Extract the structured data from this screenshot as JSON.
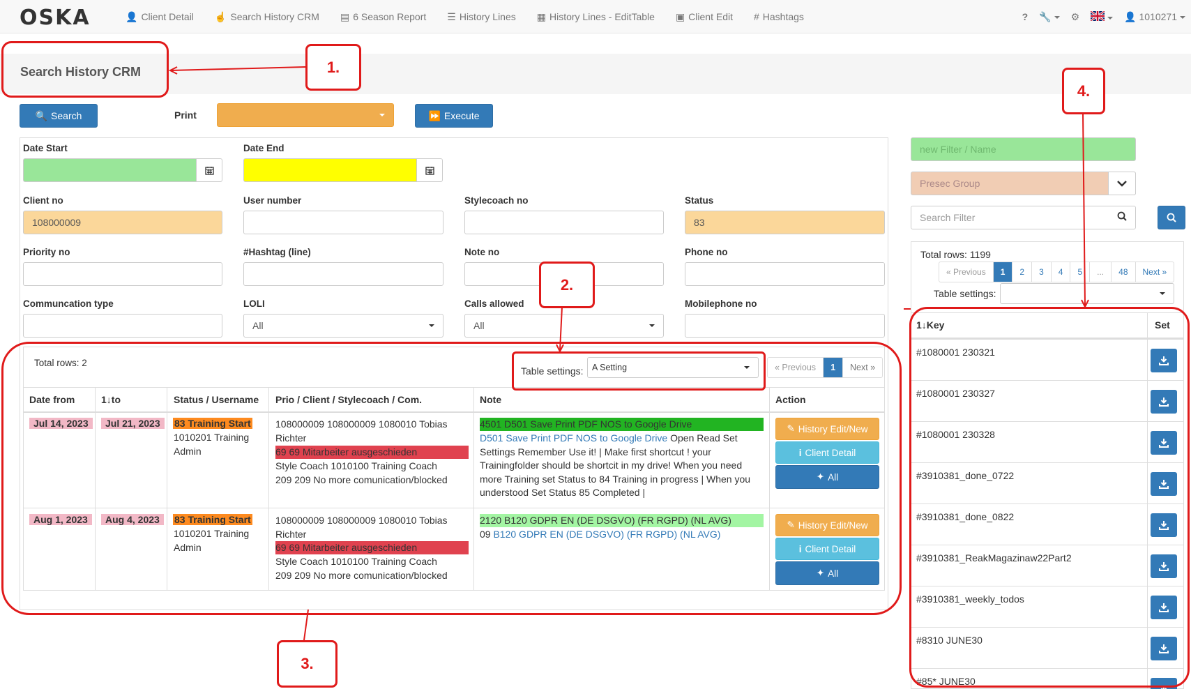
{
  "brand": "OSKA",
  "nav": {
    "items": [
      {
        "label": "Client Detail"
      },
      {
        "label": "Search History CRM"
      },
      {
        "label": "6 Season Report"
      },
      {
        "label": "History Lines"
      },
      {
        "label": "History Lines - EditTable"
      },
      {
        "label": "Client Edit"
      },
      {
        "label": "Hashtags"
      }
    ],
    "help": "?",
    "user": "1010271"
  },
  "page": {
    "title": "Search History CRM"
  },
  "toolbar": {
    "search_label": "Search",
    "print_label": "Print",
    "print_value": "",
    "execute_label": "Execute"
  },
  "form": {
    "date_start": {
      "label": "Date Start",
      "value": ""
    },
    "date_end": {
      "label": "Date End",
      "value": ""
    },
    "client_no": {
      "label": "Client no",
      "value": "108000009"
    },
    "user_number": {
      "label": "User number",
      "value": ""
    },
    "stylecoach_no": {
      "label": "Stylecoach no",
      "value": ""
    },
    "status": {
      "label": "Status",
      "value": "83"
    },
    "priority_no": {
      "label": "Priority no",
      "value": ""
    },
    "hashtag_line": {
      "label": "#Hashtag (line)",
      "value": ""
    },
    "note_no": {
      "label": "Note no",
      "value": ""
    },
    "phone_no": {
      "label": "Phone no",
      "value": ""
    },
    "communication_type": {
      "label": "Communcation type",
      "value": ""
    },
    "loli": {
      "label": "LOLI",
      "value": "All"
    },
    "calls_allowed": {
      "label": "Calls allowed",
      "value": "All"
    },
    "mobilephone_no": {
      "label": "Mobilephone no",
      "value": ""
    }
  },
  "results": {
    "total": "Total rows: 2",
    "table_settings_label": "Table settings:",
    "table_settings_value": "A Setting",
    "pager": {
      "prev": "« Previous",
      "page": "1",
      "next": "Next »"
    },
    "columns": [
      "Date from",
      "1↓to",
      "Status / Username",
      "Prio / Client / Stylecoach / Com.",
      "Note",
      "Action"
    ],
    "rows": [
      {
        "date_from": "Jul 14, 2023",
        "date_to": "Jul 21, 2023",
        "status_tag": "83 Training Start",
        "username": "1010201 Training Admin",
        "client_line": "108000009 108000009 1080010 Tobias Richter",
        "prio_tag": "69 69 Mitarbeiter ausgeschieden",
        "stylecoach": "Style Coach 1010100 Training Coach",
        "com": "209 209 No more comunication/blocked",
        "note_tag": "4501 D501 Save Print PDF NOS to Google Drive",
        "note_link": "D501 Save Print PDF NOS to Google Drive",
        "note_text": " Open Read Set Settings Remember Use it! | Make first shortcut ! your Trainingfolder should be shortcit in my drive! When you need more Training set Status to 84 Training in progress | When you understood Set Status 85 Completed |",
        "note_prefix": ""
      },
      {
        "date_from": "Aug 1, 2023",
        "date_to": "Aug 4, 2023",
        "status_tag": "83 Training Start",
        "username": "1010201 Training Admin",
        "client_line": "108000009 108000009 1080010 Tobias Richter",
        "prio_tag": "69 69 Mitarbeiter ausgeschieden",
        "stylecoach": "Style Coach 1010100 Training Coach",
        "com": "209 209 No more comunication/blocked",
        "note_tag": "2120 B120 GDPR EN (DE DSGVO) (FR RGPD) (NL AVG)",
        "note_prefix": "09 ",
        "note_link": "B120 GDPR EN (DE DSGVO) (FR RGPD) (NL AVG)",
        "note_text": ""
      }
    ],
    "actions": {
      "history_edit": "History Edit/New",
      "client_detail": "Client Detail",
      "all": "All"
    }
  },
  "filters": {
    "new_filter_placeholder": "new Filter / Name",
    "presec_group_placeholder": "Presec Group",
    "search_filter_placeholder": "Search Filter",
    "total": "Total rows: 1199",
    "pager": [
      "« Previous",
      "1",
      "2",
      "3",
      "4",
      "5",
      "...",
      "48",
      "Next »"
    ],
    "table_settings_label": "Table settings:",
    "key_header": "1↓Key",
    "set_header": "Set",
    "keys": [
      "#1080001 230321",
      "#1080001 230327",
      "#1080001 230328",
      "#3910381_done_0722",
      "#3910381_done_0822",
      "#3910381_ReakMagazinaw22Part2",
      "#3910381_weekly_todos",
      "#8310 JUNE30",
      "#85* JUNE30"
    ]
  },
  "annotations": {
    "a1": "1.",
    "a2": "2.",
    "a3": "3.",
    "a4": "4."
  },
  "colors": {
    "primary": "#337ab7",
    "warning": "#f0ad4e",
    "info": "#5bc0de",
    "annotation": "#e01a1a",
    "green_field": "#99e699",
    "yellow_field": "#ffff00",
    "peach_field": "#fbd79a"
  }
}
